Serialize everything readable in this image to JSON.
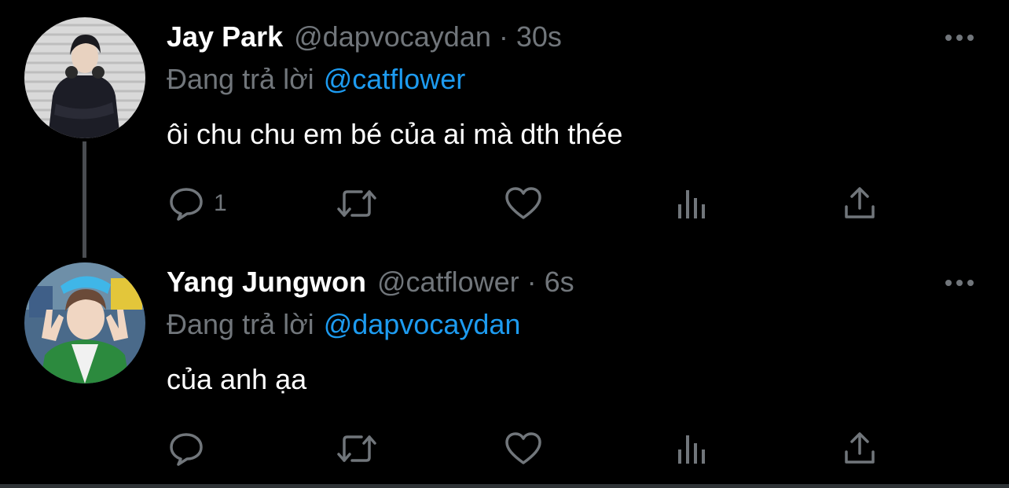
{
  "theme": {
    "background": "#000000",
    "text_primary": "#ffffff",
    "text_secondary": "#71767b",
    "link": "#1d9bf0",
    "thread_line": "#4a4d51"
  },
  "tweets": [
    {
      "name": "Jay Park",
      "handle": "@dapvocaydan",
      "separator": "·",
      "time": "30s",
      "reply_label": "Đang trả lời",
      "reply_to": "@catflower",
      "text": "ôi chu chu em bé của ai mà dth thée",
      "more_icon": "more-options-icon",
      "actions": {
        "reply_icon": "reply-icon",
        "reply_count": "1",
        "retweet_icon": "retweet-icon",
        "like_icon": "heart-icon",
        "views_icon": "analytics-icon",
        "share_icon": "share-icon"
      }
    },
    {
      "name": "Yang Jungwon",
      "handle": "@catflower",
      "separator": "·",
      "time": "6s",
      "reply_label": "Đang trả lời",
      "reply_to": "@dapvocaydan",
      "text": "của anh ạa",
      "more_icon": "more-options-icon",
      "actions": {
        "reply_icon": "reply-icon",
        "reply_count": "",
        "retweet_icon": "retweet-icon",
        "like_icon": "heart-icon",
        "views_icon": "analytics-icon",
        "share_icon": "share-icon"
      }
    }
  ]
}
